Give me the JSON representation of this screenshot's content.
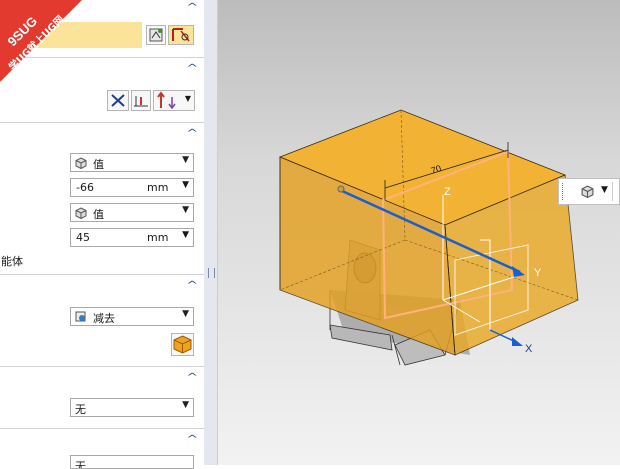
{
  "logo": {
    "line1": "9SUG",
    "line2": "学UG就上UG网"
  },
  "panel": {
    "section2_suffix": "能体",
    "start": {
      "option": "值",
      "value": "-66",
      "unit": "mm"
    },
    "end": {
      "option": "值",
      "value": "45",
      "unit": "mm"
    },
    "boolean": {
      "option": "减去"
    },
    "draft": {
      "option": "无"
    },
    "offset": {
      "option": "无"
    }
  },
  "viewport": {
    "dim_label": "70",
    "axis_x": "X",
    "axis_y": "Y",
    "axis_z": "Z"
  },
  "colors": {
    "accent_orange": "#f5a623",
    "solid_orange": "#e8a023",
    "axis_blue": "#1a5fd0",
    "chevron": "#1f4a8c"
  },
  "icons": [
    "selected-curve-icon",
    "sketch-section-icon",
    "reverse-direction-icon",
    "vector-icon",
    "value-cube-icon",
    "boolean-subtract-icon",
    "body-cube-icon"
  ]
}
